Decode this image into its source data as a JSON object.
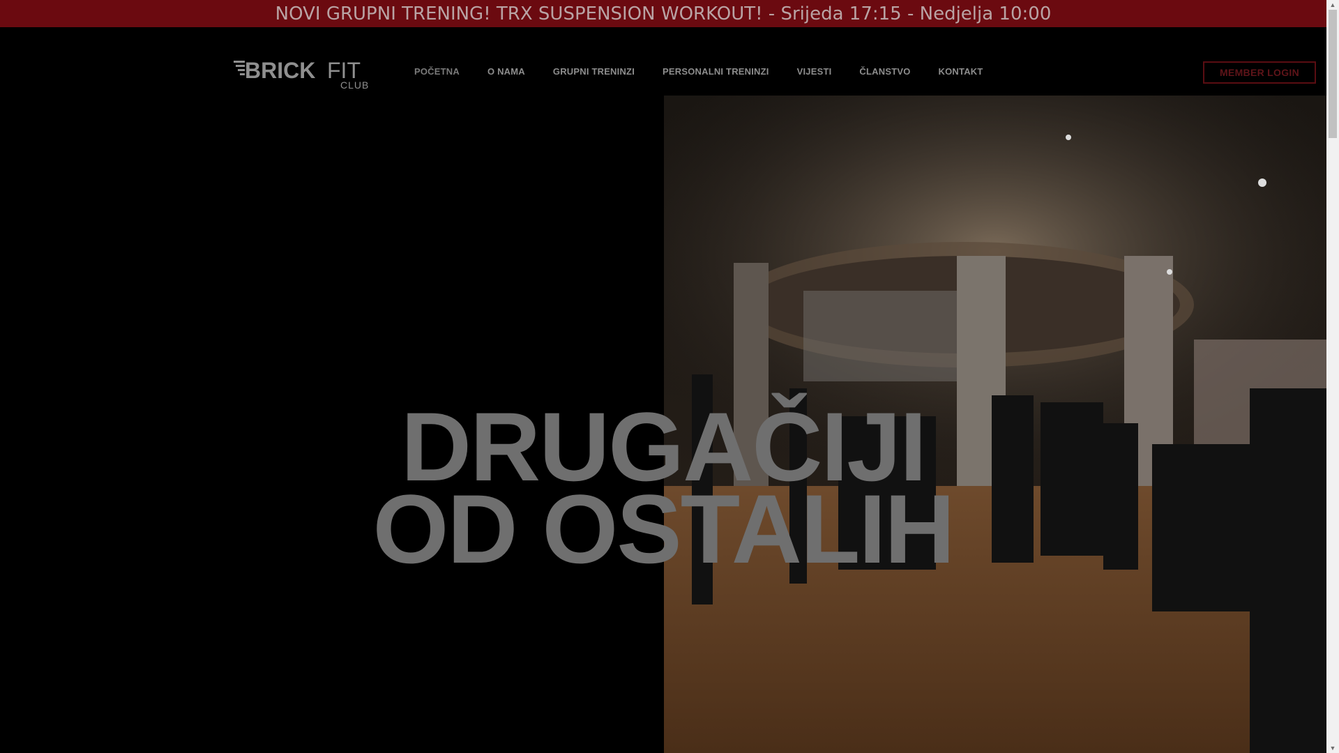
{
  "announcement": "NOVI GRUPNI TRENING! TRX SUSPENSION WORKOUT! - Srijeda 17:15 - Nedjelja 10:00",
  "logo": {
    "brand": "BRICK",
    "brand2": "FIT",
    "sub": "CLUB"
  },
  "nav": {
    "items": [
      {
        "label": "POČETNA"
      },
      {
        "label": "O NAMA"
      },
      {
        "label": "GRUPNI TRENINZI"
      },
      {
        "label": "PERSONALNI TRENINZI"
      },
      {
        "label": "VIJESTI"
      },
      {
        "label": "ČLANSTVO"
      },
      {
        "label": "KONTAKT"
      }
    ]
  },
  "login_label": "MEMBER LOGIN",
  "hero": {
    "line1": "DRUGAČIJI",
    "line2": "OD OSTALIH"
  },
  "colors": {
    "announcement_bg": "#6b0a10",
    "accent": "#5a0d12",
    "background": "#000000"
  },
  "icons": {
    "scroll_up": "triangle-up-icon",
    "scroll_down": "triangle-down-icon"
  }
}
